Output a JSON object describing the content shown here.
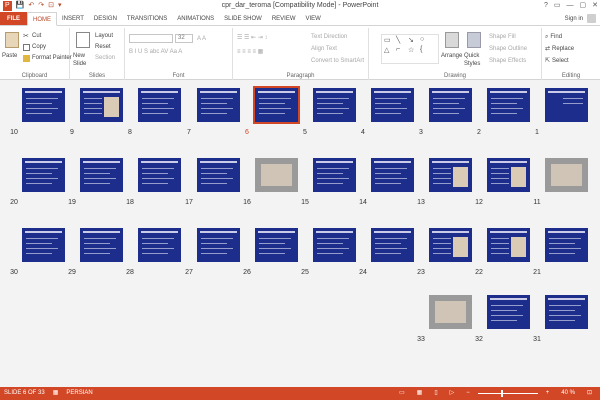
{
  "window": {
    "title": "cpr_dar_teroma [Compatibility Mode] - PowerPoint",
    "controls": [
      "?",
      "▭",
      "—",
      "▢",
      "✕"
    ]
  },
  "qat": {
    "save": "💾",
    "undo": "↶",
    "redo": "↷",
    "present": "⊡",
    "customize": "▾"
  },
  "tabs": [
    "FILE",
    "HOME",
    "INSERT",
    "DESIGN",
    "TRANSITIONS",
    "ANIMATIONS",
    "SLIDE SHOW",
    "REVIEW",
    "VIEW"
  ],
  "active_tab": "HOME",
  "signin": "Sign in",
  "ribbon": {
    "clipboard": {
      "label": "Clipboard",
      "paste": "Paste",
      "cut": "Cut",
      "copy": "Copy",
      "format_painter": "Format Painter"
    },
    "slides": {
      "label": "Slides",
      "new_slide": "New Slide",
      "layout": "Layout",
      "reset": "Reset",
      "section": "Section"
    },
    "font": {
      "label": "Font",
      "size": "32"
    },
    "paragraph": {
      "label": "Paragraph",
      "text_direction": "Text Direction",
      "align_text": "Align Text",
      "convert_smartart": "Convert to SmartArt"
    },
    "drawing": {
      "label": "Drawing",
      "arrange": "Arrange",
      "quick_styles": "Quick Styles",
      "shape_fill": "Shape Fill",
      "shape_outline": "Shape Outline",
      "shape_effects": "Shape Effects"
    },
    "editing": {
      "label": "Editing",
      "find": "Find",
      "replace": "Replace",
      "select": "Select"
    }
  },
  "slides": [
    {
      "n": 1,
      "kind": "title"
    },
    {
      "n": 2,
      "kind": "blue"
    },
    {
      "n": 3,
      "kind": "blue"
    },
    {
      "n": 4,
      "kind": "blue"
    },
    {
      "n": 5,
      "kind": "blue"
    },
    {
      "n": 6,
      "kind": "blue",
      "selected": true
    },
    {
      "n": 7,
      "kind": "blue"
    },
    {
      "n": 8,
      "kind": "blue"
    },
    {
      "n": 9,
      "kind": "image"
    },
    {
      "n": 10,
      "kind": "blue"
    },
    {
      "n": 11,
      "kind": "photo"
    },
    {
      "n": 12,
      "kind": "image"
    },
    {
      "n": 13,
      "kind": "image"
    },
    {
      "n": 14,
      "kind": "blue"
    },
    {
      "n": 15,
      "kind": "blue"
    },
    {
      "n": 16,
      "kind": "photo"
    },
    {
      "n": 17,
      "kind": "blue"
    },
    {
      "n": 18,
      "kind": "blue"
    },
    {
      "n": 19,
      "kind": "blue"
    },
    {
      "n": 20,
      "kind": "blue"
    },
    {
      "n": 21,
      "kind": "blue"
    },
    {
      "n": 22,
      "kind": "image"
    },
    {
      "n": 23,
      "kind": "image"
    },
    {
      "n": 24,
      "kind": "blue"
    },
    {
      "n": 25,
      "kind": "blue"
    },
    {
      "n": 26,
      "kind": "blue"
    },
    {
      "n": 27,
      "kind": "blue"
    },
    {
      "n": 28,
      "kind": "blue"
    },
    {
      "n": 29,
      "kind": "blue"
    },
    {
      "n": 30,
      "kind": "blue"
    },
    {
      "n": 31,
      "kind": "blue"
    },
    {
      "n": 32,
      "kind": "blue"
    },
    {
      "n": 33,
      "kind": "photo"
    }
  ],
  "status": {
    "slide_info": "SLIDE 6 OF 33",
    "language": "PERSIAN",
    "zoom": "40 %",
    "zoom_fraction": 0.4
  },
  "colors": {
    "accent": "#d24726",
    "slide_bg": "#1c2d8c"
  }
}
